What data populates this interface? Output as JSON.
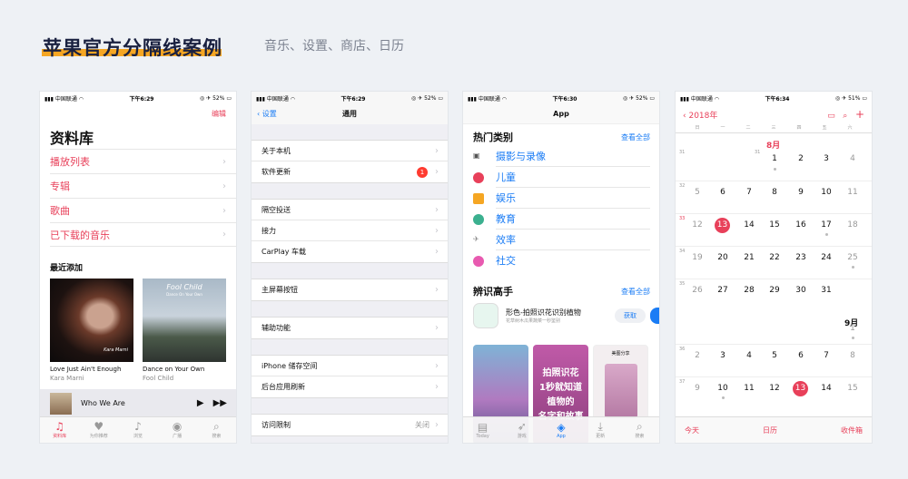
{
  "header": {
    "title": "苹果官方分隔线案例",
    "subtitle": "音乐、设置、商店、日历"
  },
  "status": {
    "carrier": "中国联通",
    "time1": "下午6:29",
    "time2": "下午6:29",
    "time3": "下午6:30",
    "time4": "下午6:34",
    "bat1": "52%",
    "bat2": "52%",
    "bat3": "52%",
    "bat4": "51%"
  },
  "music": {
    "edit": "编辑",
    "library": "资料库",
    "rows": [
      "播放列表",
      "专辑",
      "歌曲",
      "已下载的音乐"
    ],
    "recent": "最近添加",
    "albums": [
      {
        "title": "Love Just Ain't Enough",
        "artist": "Kara Marni",
        "art": "Kara Marni"
      },
      {
        "title": "Dance on Your Own",
        "artist": "Fool Child",
        "art": "Fool Child",
        "art_sub": "Dance On Your Own"
      }
    ],
    "now_playing": "Who We Are",
    "tabs": [
      "资料库",
      "为你推荐",
      "浏览",
      "广播",
      "搜索"
    ]
  },
  "settings": {
    "back": "设置",
    "title": "通用",
    "groups": [
      [
        "关于本机",
        "软件更新"
      ],
      [
        "隔空投送",
        "接力",
        "CarPlay 车载"
      ],
      [
        "主屏幕按钮"
      ],
      [
        "辅助功能"
      ],
      [
        "iPhone 储存空间",
        "后台应用刷新"
      ],
      [
        "访问限制"
      ]
    ],
    "badge": "1",
    "restrict_value": "关闭"
  },
  "store": {
    "title": "App",
    "hot": "热门类别",
    "see_all": "查看全部",
    "cats": [
      "摄影与录像",
      "儿童",
      "娱乐",
      "教育",
      "效率",
      "社交"
    ],
    "expert": "辨识高手",
    "see_all2": "查看全部",
    "app_name": "形色-拍照识花识别植物",
    "app_sub": "花草树木瓜果蔬菜一秒鉴别",
    "get": "获取",
    "shot2": "拍照识花",
    "shot2b": "1秒就知道",
    "shot2c": "植物的",
    "shot2d": "名字和故事",
    "shot3": "美图分享",
    "tabs": [
      "Today",
      "游戏",
      "App",
      "更新",
      "搜索"
    ]
  },
  "calendar": {
    "year": "2018年",
    "weekdays": [
      "日",
      "一",
      "二",
      "三",
      "四",
      "五",
      "六"
    ],
    "aug": "8月",
    "sep": "9月",
    "rows": [
      {
        "wn": "31",
        "days": [
          "",
          "",
          "",
          "1",
          "2",
          "3",
          "4"
        ]
      },
      {
        "wn": "32",
        "days": [
          "5",
          "6",
          "7",
          "8",
          "9",
          "10",
          "11"
        ]
      },
      {
        "wn": "33",
        "days": [
          "12",
          "13",
          "14",
          "15",
          "16",
          "17",
          "18"
        ]
      },
      {
        "wn": "34",
        "days": [
          "19",
          "20",
          "21",
          "22",
          "23",
          "24",
          "25"
        ]
      },
      {
        "wn": "35",
        "days": [
          "26",
          "27",
          "28",
          "29",
          "30",
          "31",
          ""
        ]
      },
      {
        "wn": "",
        "days": [
          "",
          "",
          "",
          "",
          "",
          "",
          "1"
        ]
      },
      {
        "wn": "36",
        "days": [
          "2",
          "3",
          "4",
          "5",
          "6",
          "7",
          "8"
        ]
      },
      {
        "wn": "37",
        "days": [
          "9",
          "10",
          "11",
          "12",
          "13",
          "14",
          "15"
        ]
      }
    ],
    "footer": [
      "今天",
      "日历",
      "收件箱"
    ]
  },
  "colors": {
    "accent_red": "#e8405a",
    "ios_blue": "#1a7cf5",
    "title_bar": "#f5a623"
  }
}
